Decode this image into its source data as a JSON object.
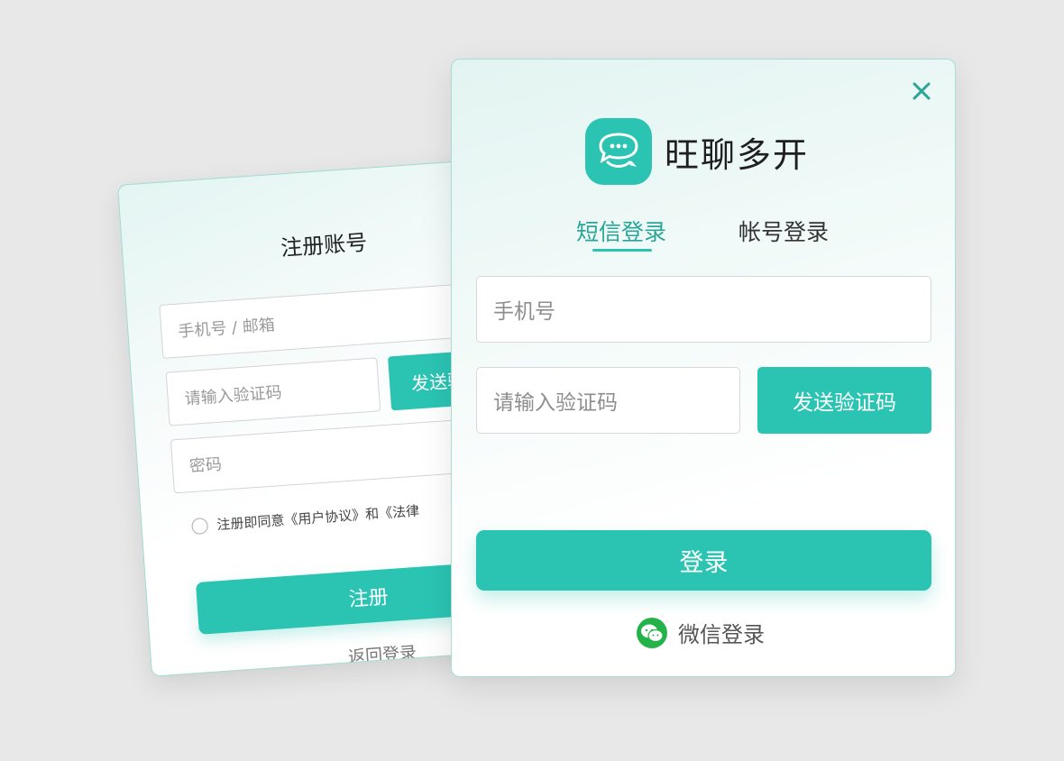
{
  "register": {
    "title": "注册账号",
    "phone_email_placeholder": "手机号 / 邮箱",
    "code_placeholder": "请输入验证码",
    "send_code_label": "发送验",
    "password_placeholder": "密码",
    "agreement_text": "注册即同意《用户协议》和《法律",
    "register_button": "注册",
    "back_to_login": "返回登录"
  },
  "login": {
    "app_name": "旺聊多开",
    "tabs": [
      {
        "label": "短信登录",
        "active": true
      },
      {
        "label": "帐号登录",
        "active": false
      }
    ],
    "phone_placeholder": "手机号",
    "code_placeholder": "请输入验证码",
    "send_code_button": "发送验证码",
    "login_button": "登录",
    "wechat_login": "微信登录"
  },
  "colors": {
    "accent": "#2bc4b3",
    "accent_dark": "#2aa597",
    "wechat": "#24b34a",
    "background": "#e8e8e8"
  },
  "icons": {
    "close": "close-icon",
    "app_logo": "chat-bubble-icon",
    "wechat": "wechat-icon"
  }
}
